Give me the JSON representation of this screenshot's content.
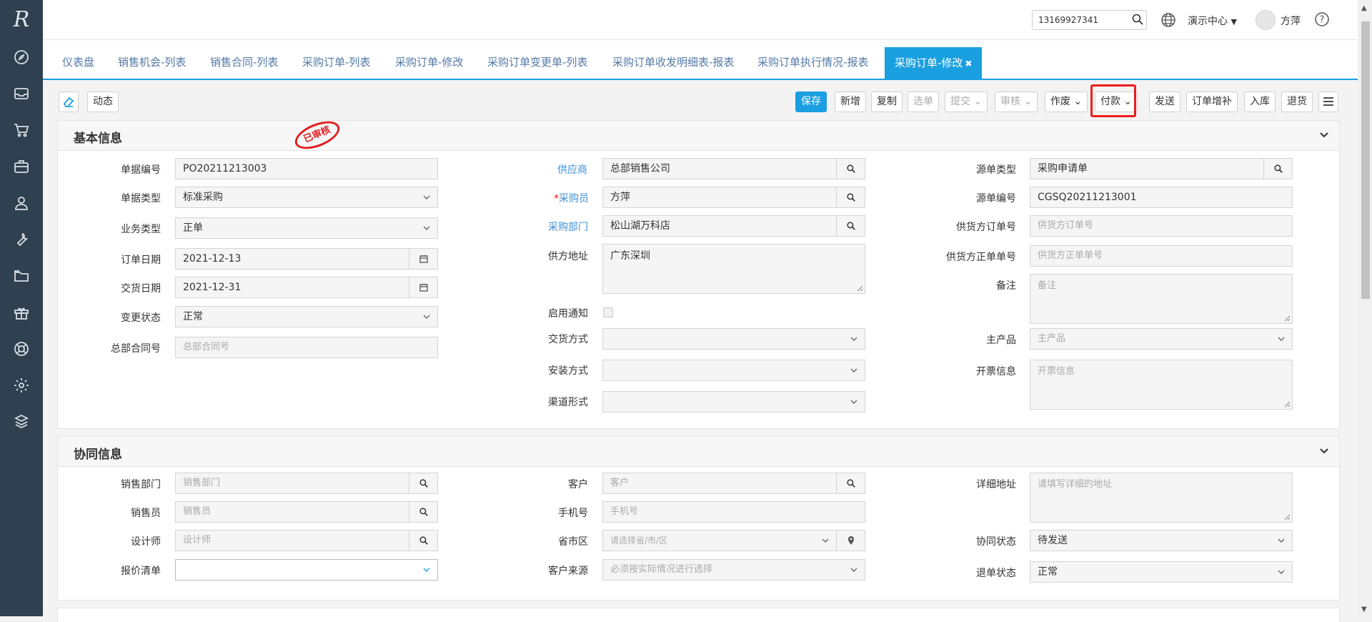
{
  "sidebar": {
    "logo": "R",
    "icons": [
      "compass-icon",
      "inbox-icon",
      "cart-icon",
      "briefcase-icon",
      "user-icon",
      "wrench-icon",
      "folder-icon",
      "gift-icon",
      "lifebuoy-icon",
      "gear-icon",
      "cube-icon"
    ]
  },
  "topbar": {
    "search_value": "13169927341",
    "center_label": "演示中心",
    "user_name": "方萍"
  },
  "tabs": [
    "仪表盘",
    "销售机会-列表",
    "销售合同-列表",
    "采购订单-列表",
    "采购订单-修改",
    "采购订单变更单-列表",
    "采购订单收发明细表-报表",
    "采购订单执行情况-报表"
  ],
  "active_tab": {
    "label": "采购订单-修改",
    "close": "✖"
  },
  "toolbar": {
    "dynamic": "动态",
    "save": "保存",
    "add": "新增",
    "copy": "复制",
    "select": "选单",
    "submit": "提交",
    "audit": "审核",
    "void": "作废",
    "pay": "付款",
    "send": "发送",
    "supplement": "订单增补",
    "stock_in": "入库",
    "return": "退货"
  },
  "basic": {
    "title": "基本信息",
    "stamp": "已审核",
    "doc_no_label": "单据编号",
    "doc_no": "PO20211213003",
    "doc_type_label": "单据类型",
    "doc_type": "标准采购",
    "biz_type_label": "业务类型",
    "biz_type": "正单",
    "order_date_label": "订单日期",
    "order_date": "2021-12-13",
    "delivery_date_label": "交货日期",
    "delivery_date": "2021-12-31",
    "change_status_label": "变更状态",
    "change_status": "正常",
    "hq_contract_label": "总部合同号",
    "hq_contract_ph": "总部合同号",
    "supplier_label": "供应商",
    "supplier": "总部销售公司",
    "buyer_req": "*",
    "buyer_label": "采购员",
    "buyer": "方萍",
    "dept_label": "采购部门",
    "dept": "松山湖万科店",
    "supplier_addr_label": "供方地址",
    "supplier_addr": "广东深圳",
    "notify_label": "启用通知",
    "delivery_method_label": "交货方式",
    "install_method_label": "安装方式",
    "channel_label": "渠道形式",
    "source_type_label": "源单类型",
    "source_type": "采购申请单",
    "source_no_label": "源单编号",
    "source_no": "CGSQ20211213001",
    "supplier_order_label": "供货方订单号",
    "supplier_order_ph": "供货方订单号",
    "supplier_formal_label": "供货方正单单号",
    "supplier_formal_ph": "供货方正单单号",
    "remark_label": "备注",
    "remark_ph": "备注",
    "main_product_label": "主产品",
    "main_product_ph": "主产品",
    "invoice_label": "开票信息",
    "invoice_ph": "开票信息"
  },
  "collab": {
    "title": "协同信息",
    "sales_dept_label": "销售部门",
    "sales_dept_ph": "销售部门",
    "salesman_label": "销售员",
    "salesman_ph": "销售员",
    "designer_label": "设计师",
    "designer_ph": "设计师",
    "quote_label": "报价清单",
    "customer_label": "客户",
    "customer_ph": "客户",
    "phone_label": "手机号",
    "phone_ph": "手机号",
    "region_label": "省市区",
    "region_ph": "请选择省/市/区",
    "source_label": "客户来源",
    "source_ph": "必须按实际情况进行选择",
    "address_label": "详细地址",
    "address_ph": "请填写详细的地址",
    "collab_status_label": "协同状态",
    "collab_status": "待发送",
    "return_status_label": "退单状态",
    "return_status": "正常"
  }
}
